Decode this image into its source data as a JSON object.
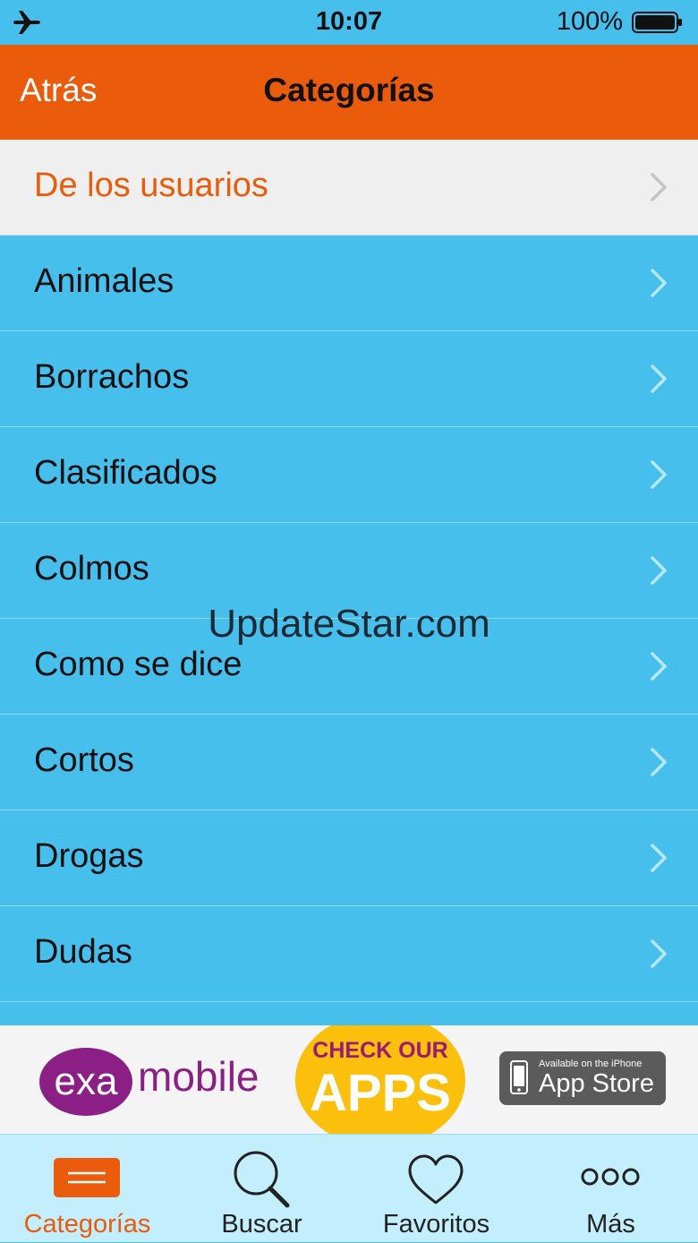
{
  "status_bar": {
    "time": "10:07",
    "battery": "100%"
  },
  "nav": {
    "back_label": "Atrás",
    "title": "Categorías"
  },
  "list": {
    "items": [
      {
        "label": "De los usuarios"
      },
      {
        "label": "Animales"
      },
      {
        "label": "Borrachos"
      },
      {
        "label": "Clasificados"
      },
      {
        "label": "Colmos"
      },
      {
        "label": "Como se dice"
      },
      {
        "label": "Cortos"
      },
      {
        "label": "Drogas"
      },
      {
        "label": "Dudas"
      }
    ]
  },
  "watermark": "UpdateStar.com",
  "ad": {
    "brand_left": "exa",
    "brand_right": "mobile",
    "cta_line1": "CHECK OUR",
    "cta_line2": "APPS",
    "store_small": "Available on the iPhone",
    "store_big": "App Store"
  },
  "tabs": [
    {
      "label": "Categorías",
      "icon": "list-icon",
      "active": true
    },
    {
      "label": "Buscar",
      "icon": "search-icon",
      "active": false
    },
    {
      "label": "Favoritos",
      "icon": "heart-icon",
      "active": false
    },
    {
      "label": "Más",
      "icon": "more-icon",
      "active": false
    }
  ],
  "colors": {
    "accent": "#ea5b0c",
    "list_bg": "#46bfec",
    "tab_bar_bg": "#c3eefd",
    "highlight_row_bg": "#efefef"
  }
}
